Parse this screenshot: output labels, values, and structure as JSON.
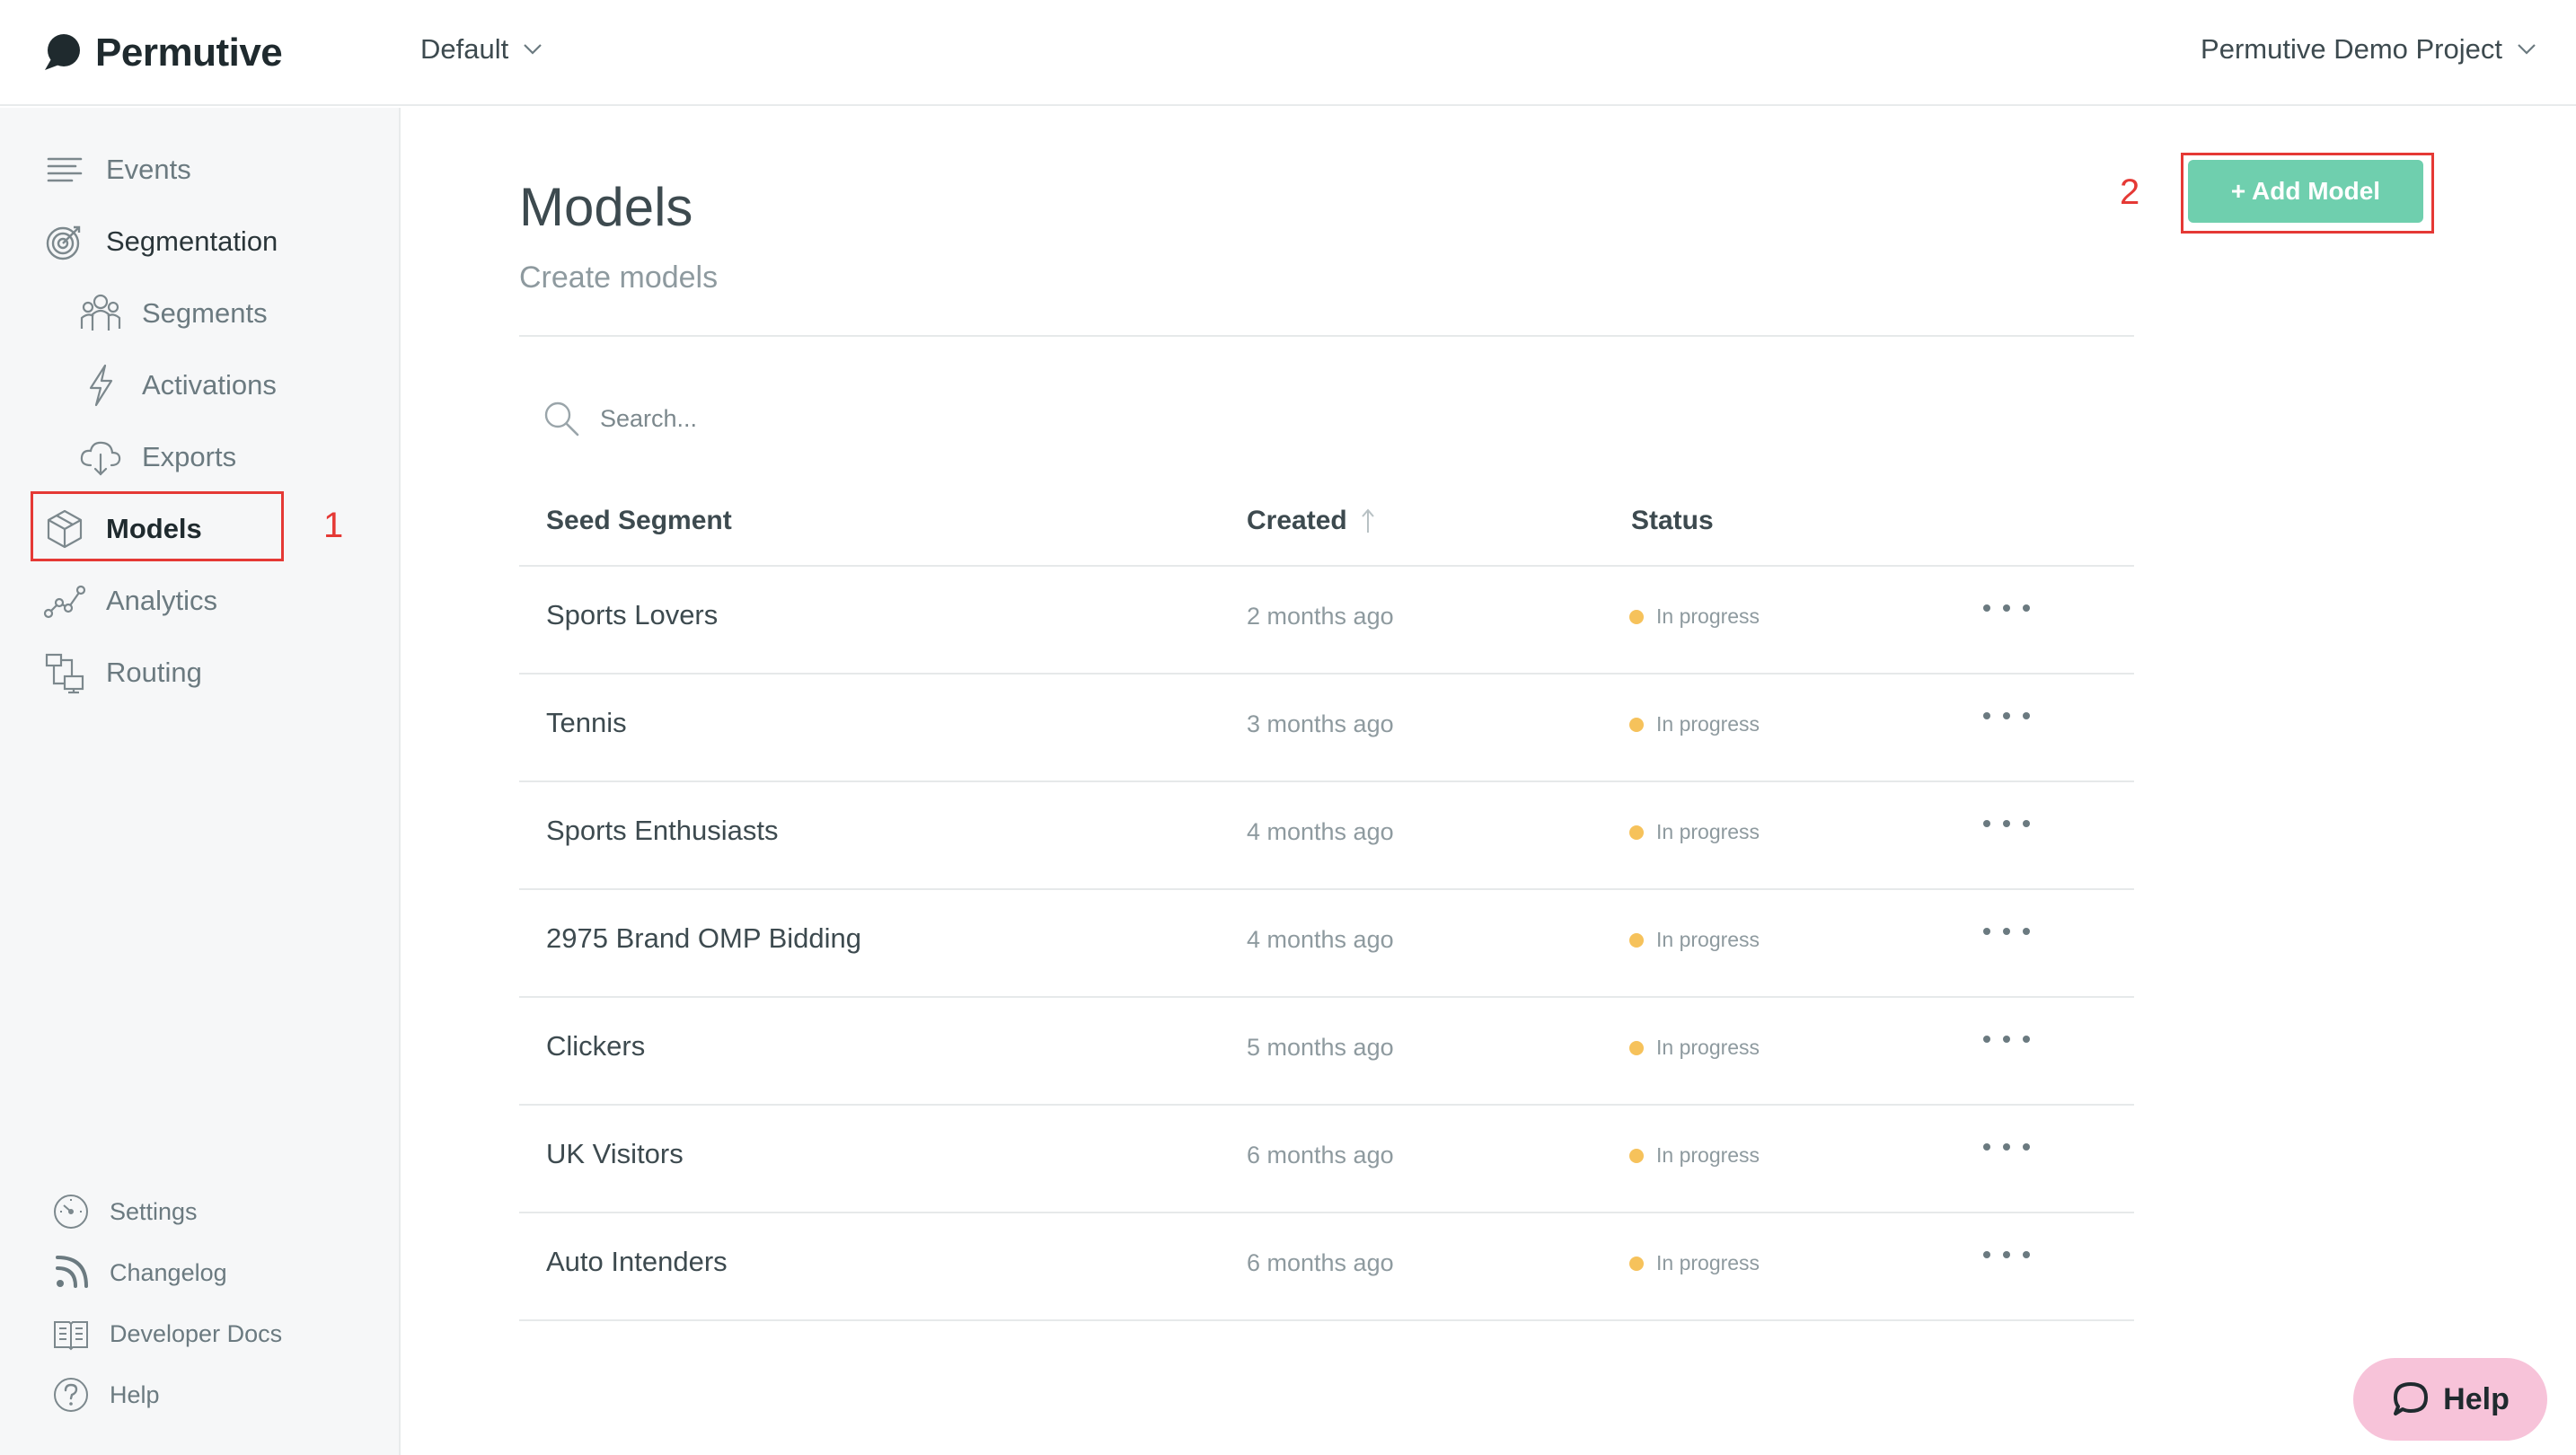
{
  "brand": {
    "name": "Permutive"
  },
  "header": {
    "workspace": "Default",
    "project": "Permutive Demo Project"
  },
  "sidebar": {
    "items": [
      {
        "label": "Events",
        "icon": "events-lines-icon"
      },
      {
        "label": "Segmentation",
        "icon": "target-icon"
      },
      {
        "label": "Segments",
        "icon": "people-icon"
      },
      {
        "label": "Activations",
        "icon": "lightning-icon"
      },
      {
        "label": "Exports",
        "icon": "cloud-download-icon"
      },
      {
        "label": "Models",
        "icon": "cube-icon",
        "active": true
      },
      {
        "label": "Analytics",
        "icon": "line-graph-icon"
      },
      {
        "label": "Routing",
        "icon": "routing-icon"
      }
    ],
    "bottom": [
      {
        "label": "Settings",
        "icon": "gauge-icon"
      },
      {
        "label": "Changelog",
        "icon": "rss-icon"
      },
      {
        "label": "Developer Docs",
        "icon": "book-icon"
      },
      {
        "label": "Help",
        "icon": "question-icon"
      }
    ]
  },
  "annotations": {
    "first": "1",
    "second": "2"
  },
  "main": {
    "title": "Models",
    "subtitle": "Create models",
    "add_button": "+ Add Model",
    "search_placeholder": "Search...",
    "columns": {
      "seed": "Seed Segment",
      "created": "Created",
      "status": "Status"
    },
    "rows": [
      {
        "name": "Sports Lovers",
        "created": "2 months ago",
        "status": "In progress"
      },
      {
        "name": "Tennis",
        "created": "3 months ago",
        "status": "In progress"
      },
      {
        "name": "Sports Enthusiasts",
        "created": "4 months ago",
        "status": "In progress"
      },
      {
        "name": "2975 Brand OMP Bidding",
        "created": "4 months ago",
        "status": "In progress"
      },
      {
        "name": "Clickers",
        "created": "5 months ago",
        "status": "In progress"
      },
      {
        "name": "UK Visitors",
        "created": "6 months ago",
        "status": "In progress"
      },
      {
        "name": "Auto Intenders",
        "created": "6 months ago",
        "status": "In progress"
      }
    ]
  },
  "help_fab": {
    "label": "Help"
  },
  "colors": {
    "accent": "#6fcfae",
    "status_dot": "#f6c25b",
    "help_bg": "#f7c3d9",
    "annotation": "#e53935"
  }
}
